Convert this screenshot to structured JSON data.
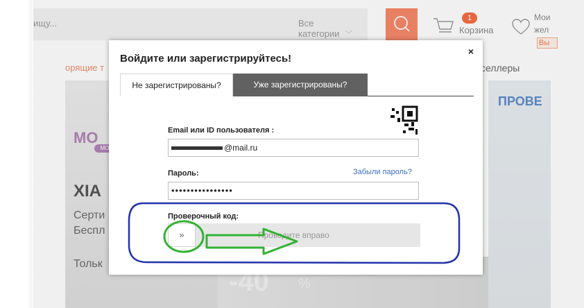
{
  "header": {
    "search_placeholder": "ищу...",
    "category": "Все категории",
    "cart_count": "1",
    "cart_label": "Корзина",
    "wish_line1": "Мои",
    "wish_line2": "жел",
    "wish_badge": "Вы"
  },
  "nav": {
    "hot": "орящие т",
    "bestsellers": "селлеры"
  },
  "banner": {
    "brand": "МО",
    "brand_sub": "МО",
    "model": "XIA",
    "line1": "Серти",
    "line2": "Беспл",
    "line3": "Тольк",
    "sale": "-40",
    "sale_pct": "%",
    "right_text": "ПРОВЕ"
  },
  "modal": {
    "title": "Войдите или зарегистрируйтесь!",
    "close": "×",
    "tab_new": "Не зарегистрированы?",
    "tab_existing": "Уже зарегистрированы?",
    "email_label": "Email или ID пользователя :",
    "email_value": "@mail.ru",
    "password_label": "Пароль:",
    "forgot_link": "Забыли пароль?",
    "password_value": "••••••••••••••••",
    "captcha_label": "Проверочный код:",
    "slider_handle": "»",
    "slider_text": "Проведите вправо"
  },
  "colors": {
    "accent": "#f7886b",
    "annotation_blue": "#2233aa",
    "annotation_green": "#33b233",
    "tab_active": "#616161",
    "link": "#3a6ec4"
  }
}
